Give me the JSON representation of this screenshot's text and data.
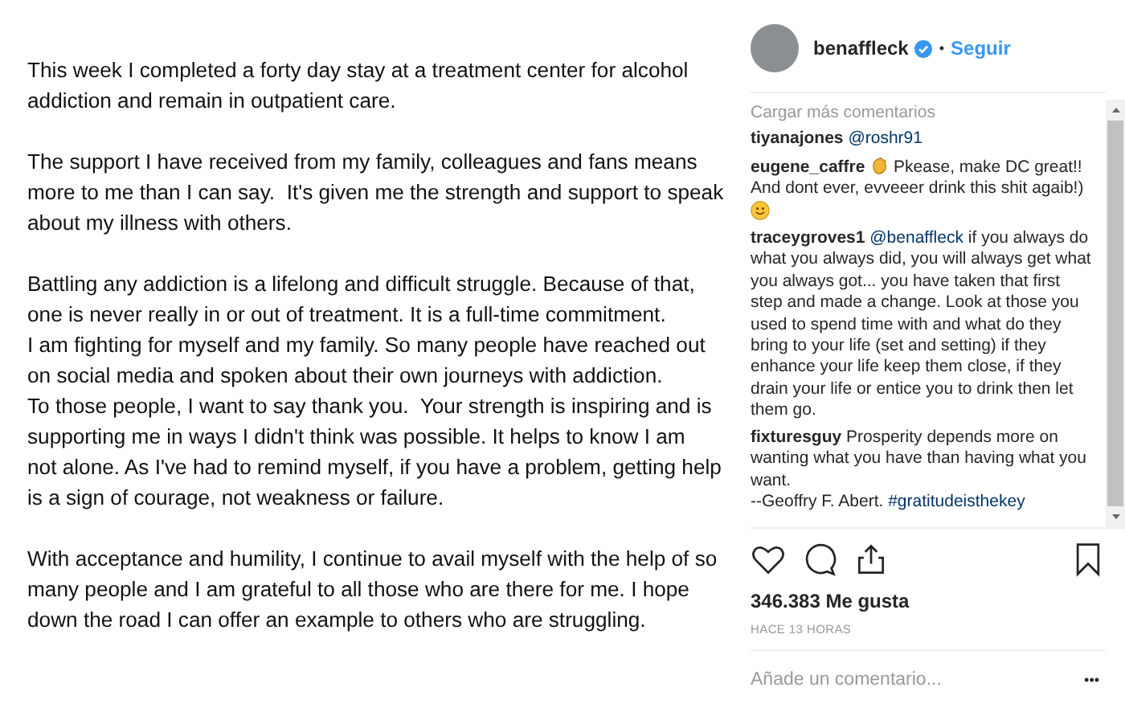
{
  "post_text": {
    "paragraphs": [
      {
        "lines": [
          "This week I completed a forty day stay at a treatment center for alcohol",
          "addiction and remain in outpatient care."
        ]
      },
      {
        "lines": [
          "The support I have received from my family, colleagues and fans means",
          "more to me than I can say.  It's given me the strength and support to speak",
          "about my illness with others."
        ]
      },
      {
        "lines": [
          "Battling any addiction is a lifelong and difficult struggle. Because of that,",
          "one is never really in or out of treatment. It is a full-time commitment.",
          "I am fighting for myself and my family. So many people have reached out",
          "on social media and spoken about their own journeys with addiction.",
          "To those people, I want to say thank you.  Your strength is inspiring and is",
          "supporting me in ways I didn't think was possible. It helps to know I am",
          "not alone. As I've had to remind myself, if you have a problem, getting help",
          "is a sign of courage, not weakness or failure."
        ]
      },
      {
        "lines": [
          "With acceptance and humility, I continue to avail myself with the help of so",
          "many people and I am grateful to all those who are there for me. I hope",
          "down the road I can offer an example to others who are struggling."
        ]
      }
    ]
  },
  "header": {
    "username": "benaffleck",
    "verified": true,
    "separator": "•",
    "follow": "Seguir"
  },
  "load_more": "Cargar más comentarios",
  "comments": [
    {
      "user": "tiyanajones",
      "parts": [
        {
          "kind": "link",
          "text": "@roshr91"
        }
      ]
    },
    {
      "user": "eugene_caffre",
      "parts": [
        {
          "kind": "hand-emoji"
        },
        {
          "kind": "text",
          "text": "Pkease, make DC great!! And dont ever, evveeer drink this shit agaib!)"
        },
        {
          "kind": "smile-emoji"
        }
      ]
    },
    {
      "user": "traceygroves1",
      "parts": [
        {
          "kind": "link",
          "text": "@benaffleck"
        },
        {
          "kind": "text",
          "text": "if you always do what you always did, you will always get what you always got... you have taken that first step and made a change. Look at those you used to spend time with and what do they bring to your life (set and setting) if they enhance your life keep them close, if they drain your life or entice you to drink then let them go."
        }
      ]
    },
    {
      "user": "fixturesguy",
      "parts": [
        {
          "kind": "text",
          "text": "Prosperity depends more on wanting what you have than having what you want."
        },
        {
          "kind": "break"
        },
        {
          "kind": "text",
          "text": "--Geoffry F. Abert."
        },
        {
          "kind": "link",
          "text": "#gratitudeisthekey"
        }
      ]
    }
  ],
  "likes": "346.383 Me gusta",
  "time": "HACE 13 HORAS",
  "comment_input": {
    "placeholder": "Añade un comentario..."
  },
  "more_button": "•••"
}
